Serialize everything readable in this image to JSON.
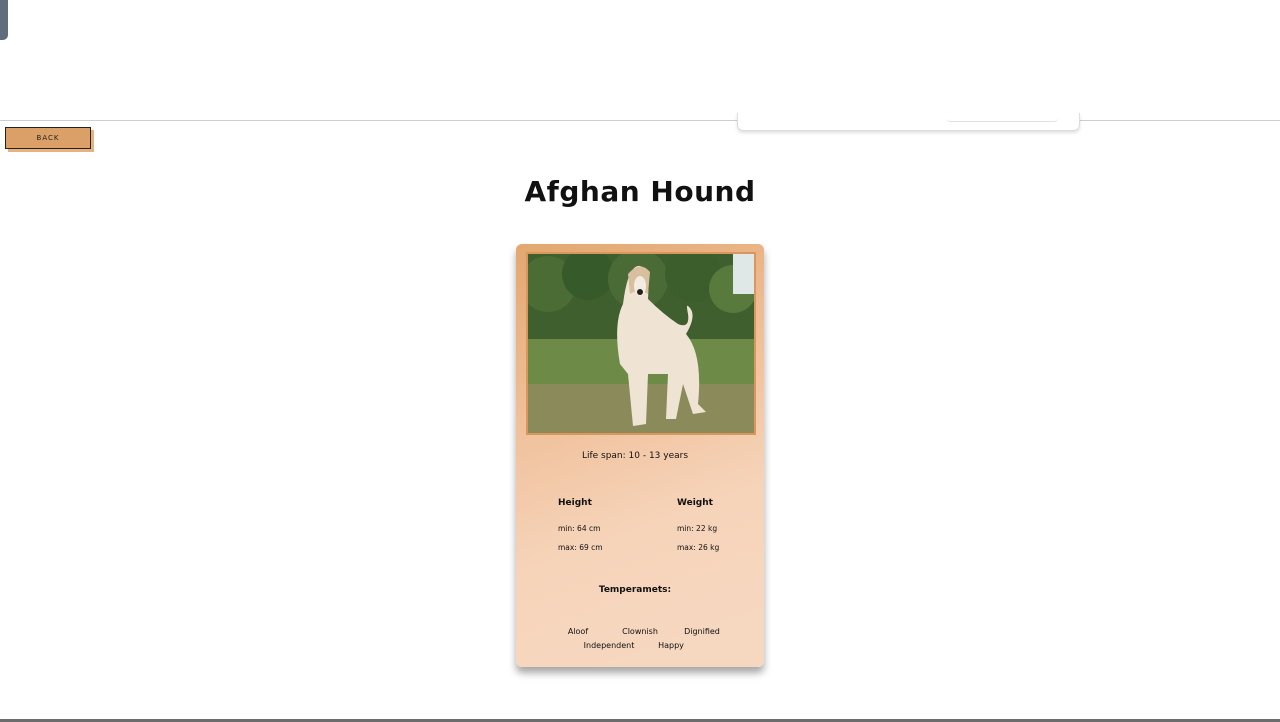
{
  "header": {
    "back_label": "BACK"
  },
  "breed": {
    "name": "Afghan Hound",
    "image_alt": "Afghan Hound standing on grass",
    "life_span": "Life span: 10 - 13 years",
    "height": {
      "label": "Height",
      "min": "min: 64 cm",
      "max": "max: 69 cm"
    },
    "weight": {
      "label": "Weight",
      "min": "min: 22 kg",
      "max": "max: 26 kg"
    },
    "temperament_label": "Temperamets:",
    "temperaments": [
      "Aloof",
      "Clownish",
      "Dignified",
      "Independent",
      "Happy"
    ]
  }
}
